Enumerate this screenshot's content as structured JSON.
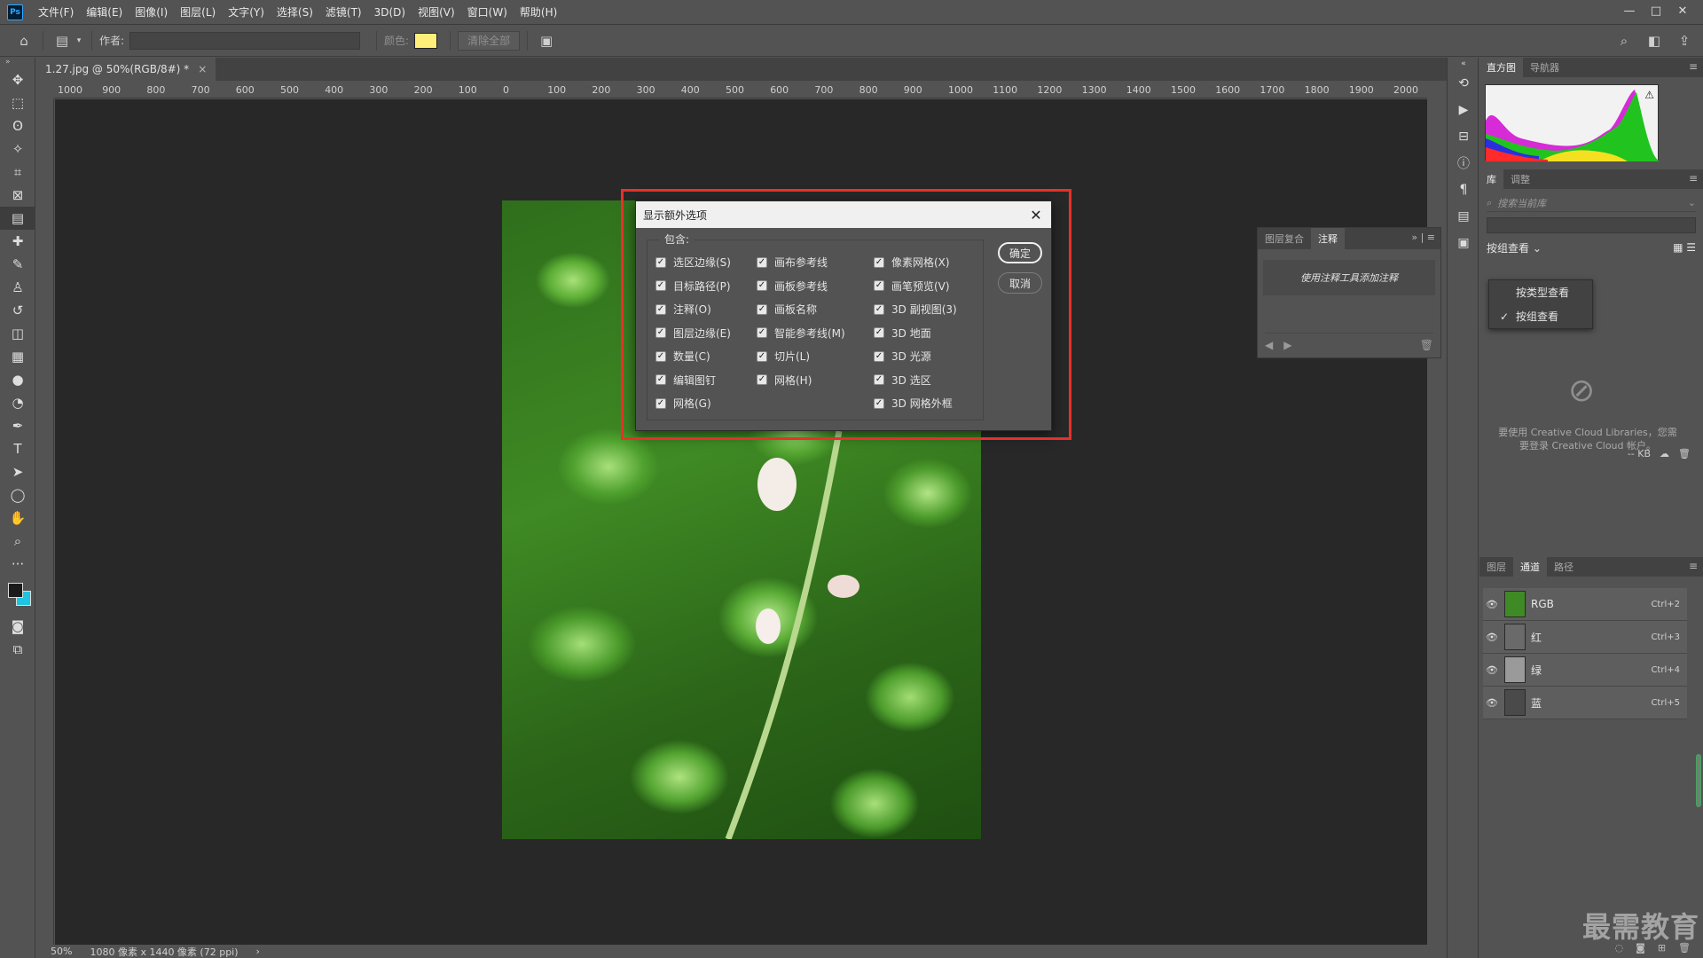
{
  "menu": {
    "logo": "Ps",
    "items": [
      "文件(F)",
      "编辑(E)",
      "图像(I)",
      "图层(L)",
      "文字(Y)",
      "选择(S)",
      "滤镜(T)",
      "3D(D)",
      "视图(V)",
      "窗口(W)",
      "帮助(H)"
    ],
    "window_controls": [
      "—",
      "□",
      "✕"
    ]
  },
  "options": {
    "author_label": "作者:",
    "author_value": "",
    "color_label": "颜色:",
    "color_value": "#ffef7a",
    "clear_all_label": "清除全部"
  },
  "document": {
    "tab_label": "1.27.jpg @ 50%(RGB/8#) *",
    "tab_close": "×",
    "ruler_h_ticks": [
      "1000",
      "900",
      "800",
      "700",
      "600",
      "500",
      "400",
      "300",
      "200",
      "100",
      "0",
      "100",
      "200",
      "300",
      "400",
      "500",
      "600",
      "700",
      "800",
      "900",
      "1000",
      "1100",
      "1200",
      "1300",
      "1400",
      "1500",
      "1600",
      "1700",
      "1800",
      "1900",
      "2000"
    ]
  },
  "dialog": {
    "title": "显示额外选项",
    "group_label": "包含:",
    "columns": [
      [
        "选区边缘(S)",
        "目标路径(P)",
        "注释(O)",
        "图层边缘(E)",
        "数量(C)",
        "编辑图钉",
        "网格(G)"
      ],
      [
        "画布参考线",
        "画板参考线",
        "画板名称",
        "智能参考线(M)",
        "切片(L)",
        "网格(H)"
      ],
      [
        "像素网格(X)",
        "画笔预览(V)",
        "3D 副视图(3)",
        "3D 地面",
        "3D 光源",
        "3D 选区",
        "3D 网格外框"
      ]
    ],
    "check_mark": "✓",
    "ok_label": "确定",
    "cancel_label": "取消"
  },
  "notes_panel": {
    "tabs": [
      "图层复合",
      "注释"
    ],
    "empty_message": "使用注释工具添加注释"
  },
  "status": {
    "zoom": "50%",
    "info": "1080 像素 x 1440 像素 (72 ppi)",
    "arrow": "›"
  },
  "right": {
    "histogram_tabs": [
      "直方图",
      "导航器"
    ],
    "library_tabs": [
      "库",
      "调整"
    ],
    "search_placeholder": "搜索当前库",
    "view_label": "按组查看",
    "view_options": [
      "按类型查看",
      "按组查看"
    ],
    "cc_message": "要使用 Creative Cloud Libraries，您需要登录 Creative Cloud 帐户。",
    "size_label": "-- KB",
    "channel_tabs": [
      "图层",
      "通道",
      "路径"
    ],
    "channels": [
      {
        "name": "RGB",
        "shortcut": "Ctrl+2"
      },
      {
        "name": "红",
        "shortcut": "Ctrl+3"
      },
      {
        "name": "绿",
        "shortcut": "Ctrl+4"
      },
      {
        "name": "蓝",
        "shortcut": "Ctrl+5"
      }
    ],
    "watermark": "最需教育"
  }
}
